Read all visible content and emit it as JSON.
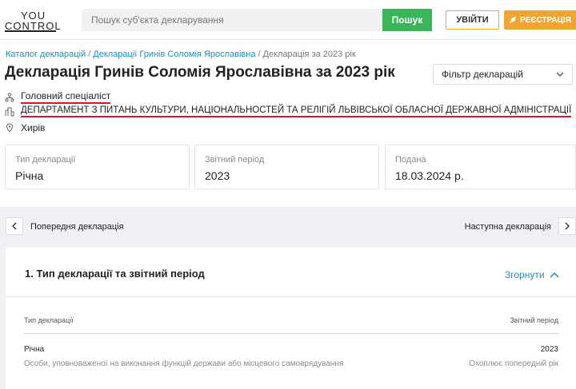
{
  "header": {
    "logo_top": "YOU",
    "logo_bottom": "CONTROL",
    "search_placeholder": "Пошук суб'єкта декларування",
    "search_label": "Пошук",
    "login_label": "УВІЙТИ",
    "register_label": "РЕЄСТРАЦІЯ",
    "accent_green": "#3bb55a",
    "accent_orange": "#f0a431"
  },
  "breadcrumb": {
    "items": [
      "Каталог декларацій",
      "Декларації Гринів Соломія Ярославівна",
      "Декларація за 2023 рік"
    ],
    "separator": "/"
  },
  "page_title": "Декларація Гринів Соломія Ярославівна за 2023 рік",
  "filter": {
    "label": "Фільтр декларацій"
  },
  "info": {
    "position": "Головний спеціаліст",
    "organization": "ДЕПАРТАМЕНТ З ПИТАНЬ КУЛЬТУРИ, НАЦІОНАЛЬНОСТЕЙ ТА РЕЛІГІЙ ЛЬВІВСЬКОЇ ОБЛАСНОЇ ДЕРЖАВНОЇ АДМІНІСТРАЦІЇ",
    "location": "Хирів",
    "icons": [
      "org-structure-icon",
      "building-icon",
      "location-pin-icon"
    ]
  },
  "cards": [
    {
      "label": "Тип декларації",
      "value": "Річна"
    },
    {
      "label": "Звітний період",
      "value": "2023"
    },
    {
      "label": "Подана",
      "value": "18.03.2024 р."
    }
  ],
  "navigation": {
    "prev_label": "Попередня декларація",
    "next_label": "Наступна декларація"
  },
  "section": {
    "title": "1. Тип декларації та звітний період",
    "collapse_label": "Згорнути",
    "table": {
      "headers": [
        "Тип декларації",
        "Звітний період"
      ],
      "row": {
        "type": "Річна",
        "type_desc": "Особи, уповноваженої на виконання функцій держави або місцевого самоврядування",
        "period": "2023",
        "period_desc": "Охоплює попередній рік"
      }
    }
  }
}
